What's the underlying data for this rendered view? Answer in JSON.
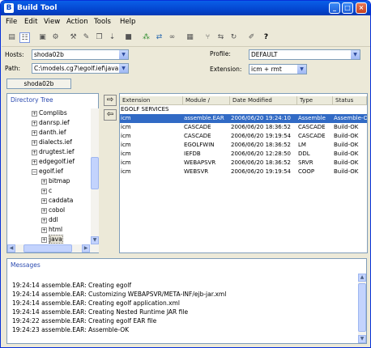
{
  "window": {
    "title": "Build Tool",
    "minimize": "_",
    "maximize": "□",
    "close": "×",
    "app_icon": "B"
  },
  "menu": [
    "File",
    "Edit",
    "View",
    "Action",
    "Tools",
    "Help"
  ],
  "toolbar": {
    "icons": [
      "list-view-icon",
      "detail-view-icon",
      "build-icon",
      "rebuild-icon",
      "hammer-icon",
      "wrench-icon",
      "copy-icon",
      "deploy-icon",
      "stop-icon",
      "network-icon",
      "connect-icon",
      "link-icon",
      "disk-icon",
      "branch-icon",
      "merge-icon",
      "checkout-icon",
      "edit-icon",
      "help-icon"
    ],
    "help_label": "?"
  },
  "form": {
    "hosts_label": "Hosts:",
    "hosts_value": "shoda02b",
    "path_label": "Path:",
    "path_value": "C:\\models.cg7\\egolf.ief\\java",
    "profile_label": "Profile:",
    "profile_value": "DEFAULT",
    "extension_label": "Extension:",
    "extension_value": "icm + rmt"
  },
  "host_tab": "shoda02b",
  "directory_tree": {
    "title": "Directory Tree",
    "items": [
      {
        "label": "Complibs",
        "level": 1,
        "expander": "+"
      },
      {
        "label": "danrsp.ief",
        "level": 1,
        "expander": "+"
      },
      {
        "label": "danth.ief",
        "level": 1,
        "expander": "+"
      },
      {
        "label": "dialects.ief",
        "level": 1,
        "expander": "+"
      },
      {
        "label": "drugtest.ief",
        "level": 1,
        "expander": "+"
      },
      {
        "label": "edgegolf.ief",
        "level": 1,
        "expander": "+"
      },
      {
        "label": "egolf.ief",
        "level": 1,
        "expander": "−"
      },
      {
        "label": "bitmap",
        "level": 2,
        "expander": "+"
      },
      {
        "label": "c",
        "level": 2,
        "expander": "+"
      },
      {
        "label": "caddata",
        "level": 2,
        "expander": "+"
      },
      {
        "label": "cobol",
        "level": 2,
        "expander": "+"
      },
      {
        "label": "ddl",
        "level": 2,
        "expander": "+"
      },
      {
        "label": "html",
        "level": 2,
        "expander": "+"
      },
      {
        "label": "java",
        "level": 2,
        "expander": "+",
        "selected": true
      }
    ]
  },
  "table": {
    "columns": [
      "Extension",
      "Module /",
      "Date Modified",
      "Type",
      "Status"
    ],
    "group": "EGOLF SERVICES",
    "rows": [
      {
        "extension": "icm",
        "module": "assemble.EAR",
        "date": "2006/06/20 19:24:10",
        "type": "Assemble",
        "status": "Assemble-OK",
        "selected": true
      },
      {
        "extension": "icm",
        "module": "CASCADE",
        "date": "2006/06/20 18:36:52",
        "type": "CASCADE",
        "status": "Build-OK"
      },
      {
        "extension": "icm",
        "module": "CASCADE",
        "date": "2006/06/20 19:19:54",
        "type": "CASCADE",
        "status": "Build-OK"
      },
      {
        "extension": "icm",
        "module": "EGOLFWIN",
        "date": "2006/06/20 18:36:52",
        "type": "LM",
        "status": "Build-OK"
      },
      {
        "extension": "icm",
        "module": "IEFDB",
        "date": "2006/06/20 12:28:50",
        "type": "DDL",
        "status": "Build-OK"
      },
      {
        "extension": "icm",
        "module": "WEBAPSVR",
        "date": "2006/06/20 18:36:52",
        "type": "SRVR",
        "status": "Build-OK"
      },
      {
        "extension": "icm",
        "module": "WEBSVR",
        "date": "2006/06/20 19:19:54",
        "type": "COOP",
        "status": "Build-OK"
      }
    ]
  },
  "messages": {
    "title": "Messages",
    "lines": [
      "19:24:14 assemble.EAR: Creating egolf",
      "19:24:14 assemble.EAR: Customizing WEBAPSVR/META-INF/ejb-jar.xml",
      "19:24:14 assemble.EAR: Creating egolf application.xml",
      "19:24:14 assemble.EAR: Creating Nested Runtime JAR file",
      "19:24:22 assemble.EAR: Creating egolf EAR file",
      "19:24:23 assemble.EAR: Assemble-OK"
    ]
  },
  "colors": {
    "selection": "#316AC5",
    "title_bar": "#0446D0",
    "panel_title": "#2C4BB0"
  }
}
